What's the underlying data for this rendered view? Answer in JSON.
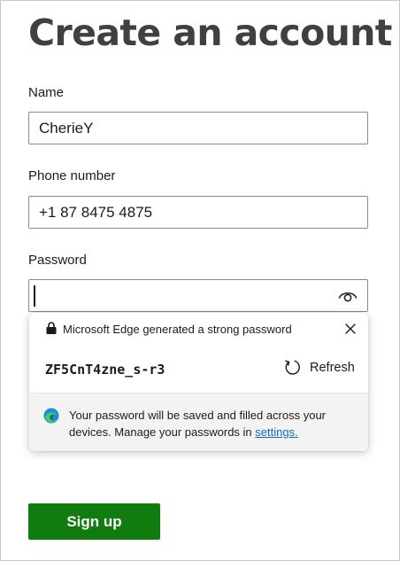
{
  "form": {
    "title": "Create an account",
    "name_label": "Name",
    "name_value": "CherieY",
    "phone_label": "Phone number",
    "phone_value": "+1 87 8475 4875",
    "password_label": "Password",
    "password_value": "",
    "signup_label": "Sign up"
  },
  "popup": {
    "title": "Microsoft Edge generated a strong password",
    "password": "ZF5CnT4zne_s-r3",
    "refresh_label": "Refresh",
    "info_text": "Your password will be saved and filled across your devices. Manage your passwords in ",
    "link_text": "settings."
  },
  "icons": {
    "lock": "lock-icon",
    "close": "close-icon",
    "refresh": "refresh-icon",
    "reveal": "eye-icon",
    "edge": "edge-logo-icon"
  },
  "colors": {
    "primary_button": "#107c10",
    "link": "#0f6cbd",
    "title": "#404040"
  }
}
